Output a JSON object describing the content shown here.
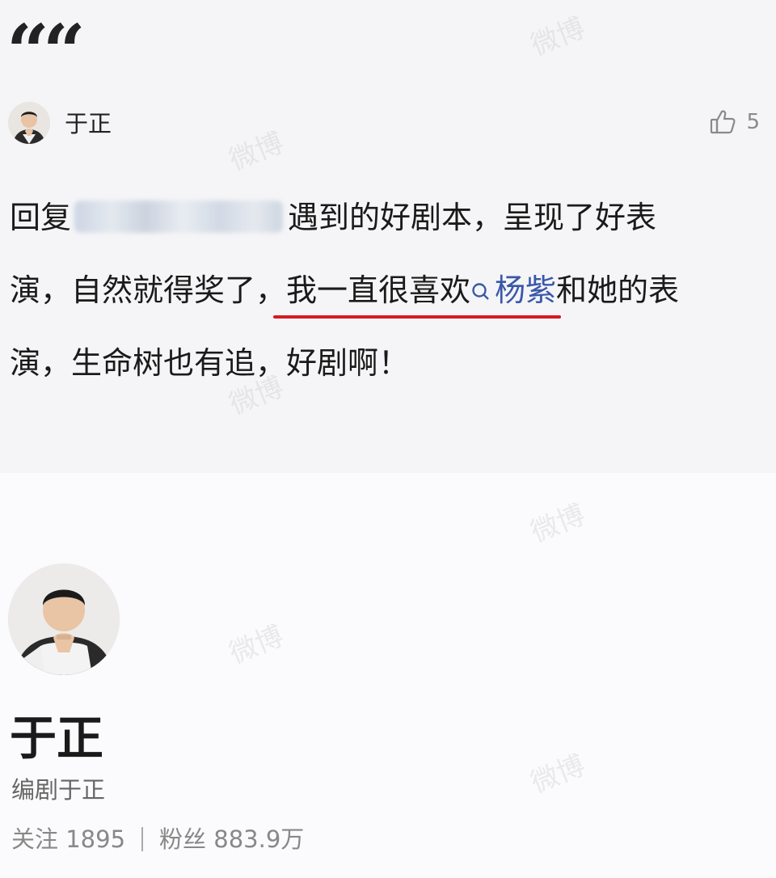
{
  "post": {
    "quote_glyph": "“",
    "author": {
      "name": "于正",
      "avatar": "avatar-photo"
    },
    "likes": {
      "icon": "thumbs-up-icon",
      "count": "5"
    },
    "comment": {
      "reply_prefix": "回复",
      "after_blur": "遇到的好剧本，呈现了好表",
      "line2_part1": "演，自然就得奖了，",
      "underlined_part": "我一直很喜欢",
      "mention_name": "杨紫",
      "line2_part2": "和她的表",
      "line3": "演，生命树也有追，好剧啊！"
    },
    "accent_colors": {
      "underline": "#d71920",
      "mention": "#3a58a8"
    }
  },
  "profile": {
    "name": "于正",
    "description": "编剧于正",
    "follow_label": "关注",
    "follow_count": "1895",
    "fans_label": "粉丝",
    "fans_count": "883.9万"
  },
  "watermark_text": "微博"
}
